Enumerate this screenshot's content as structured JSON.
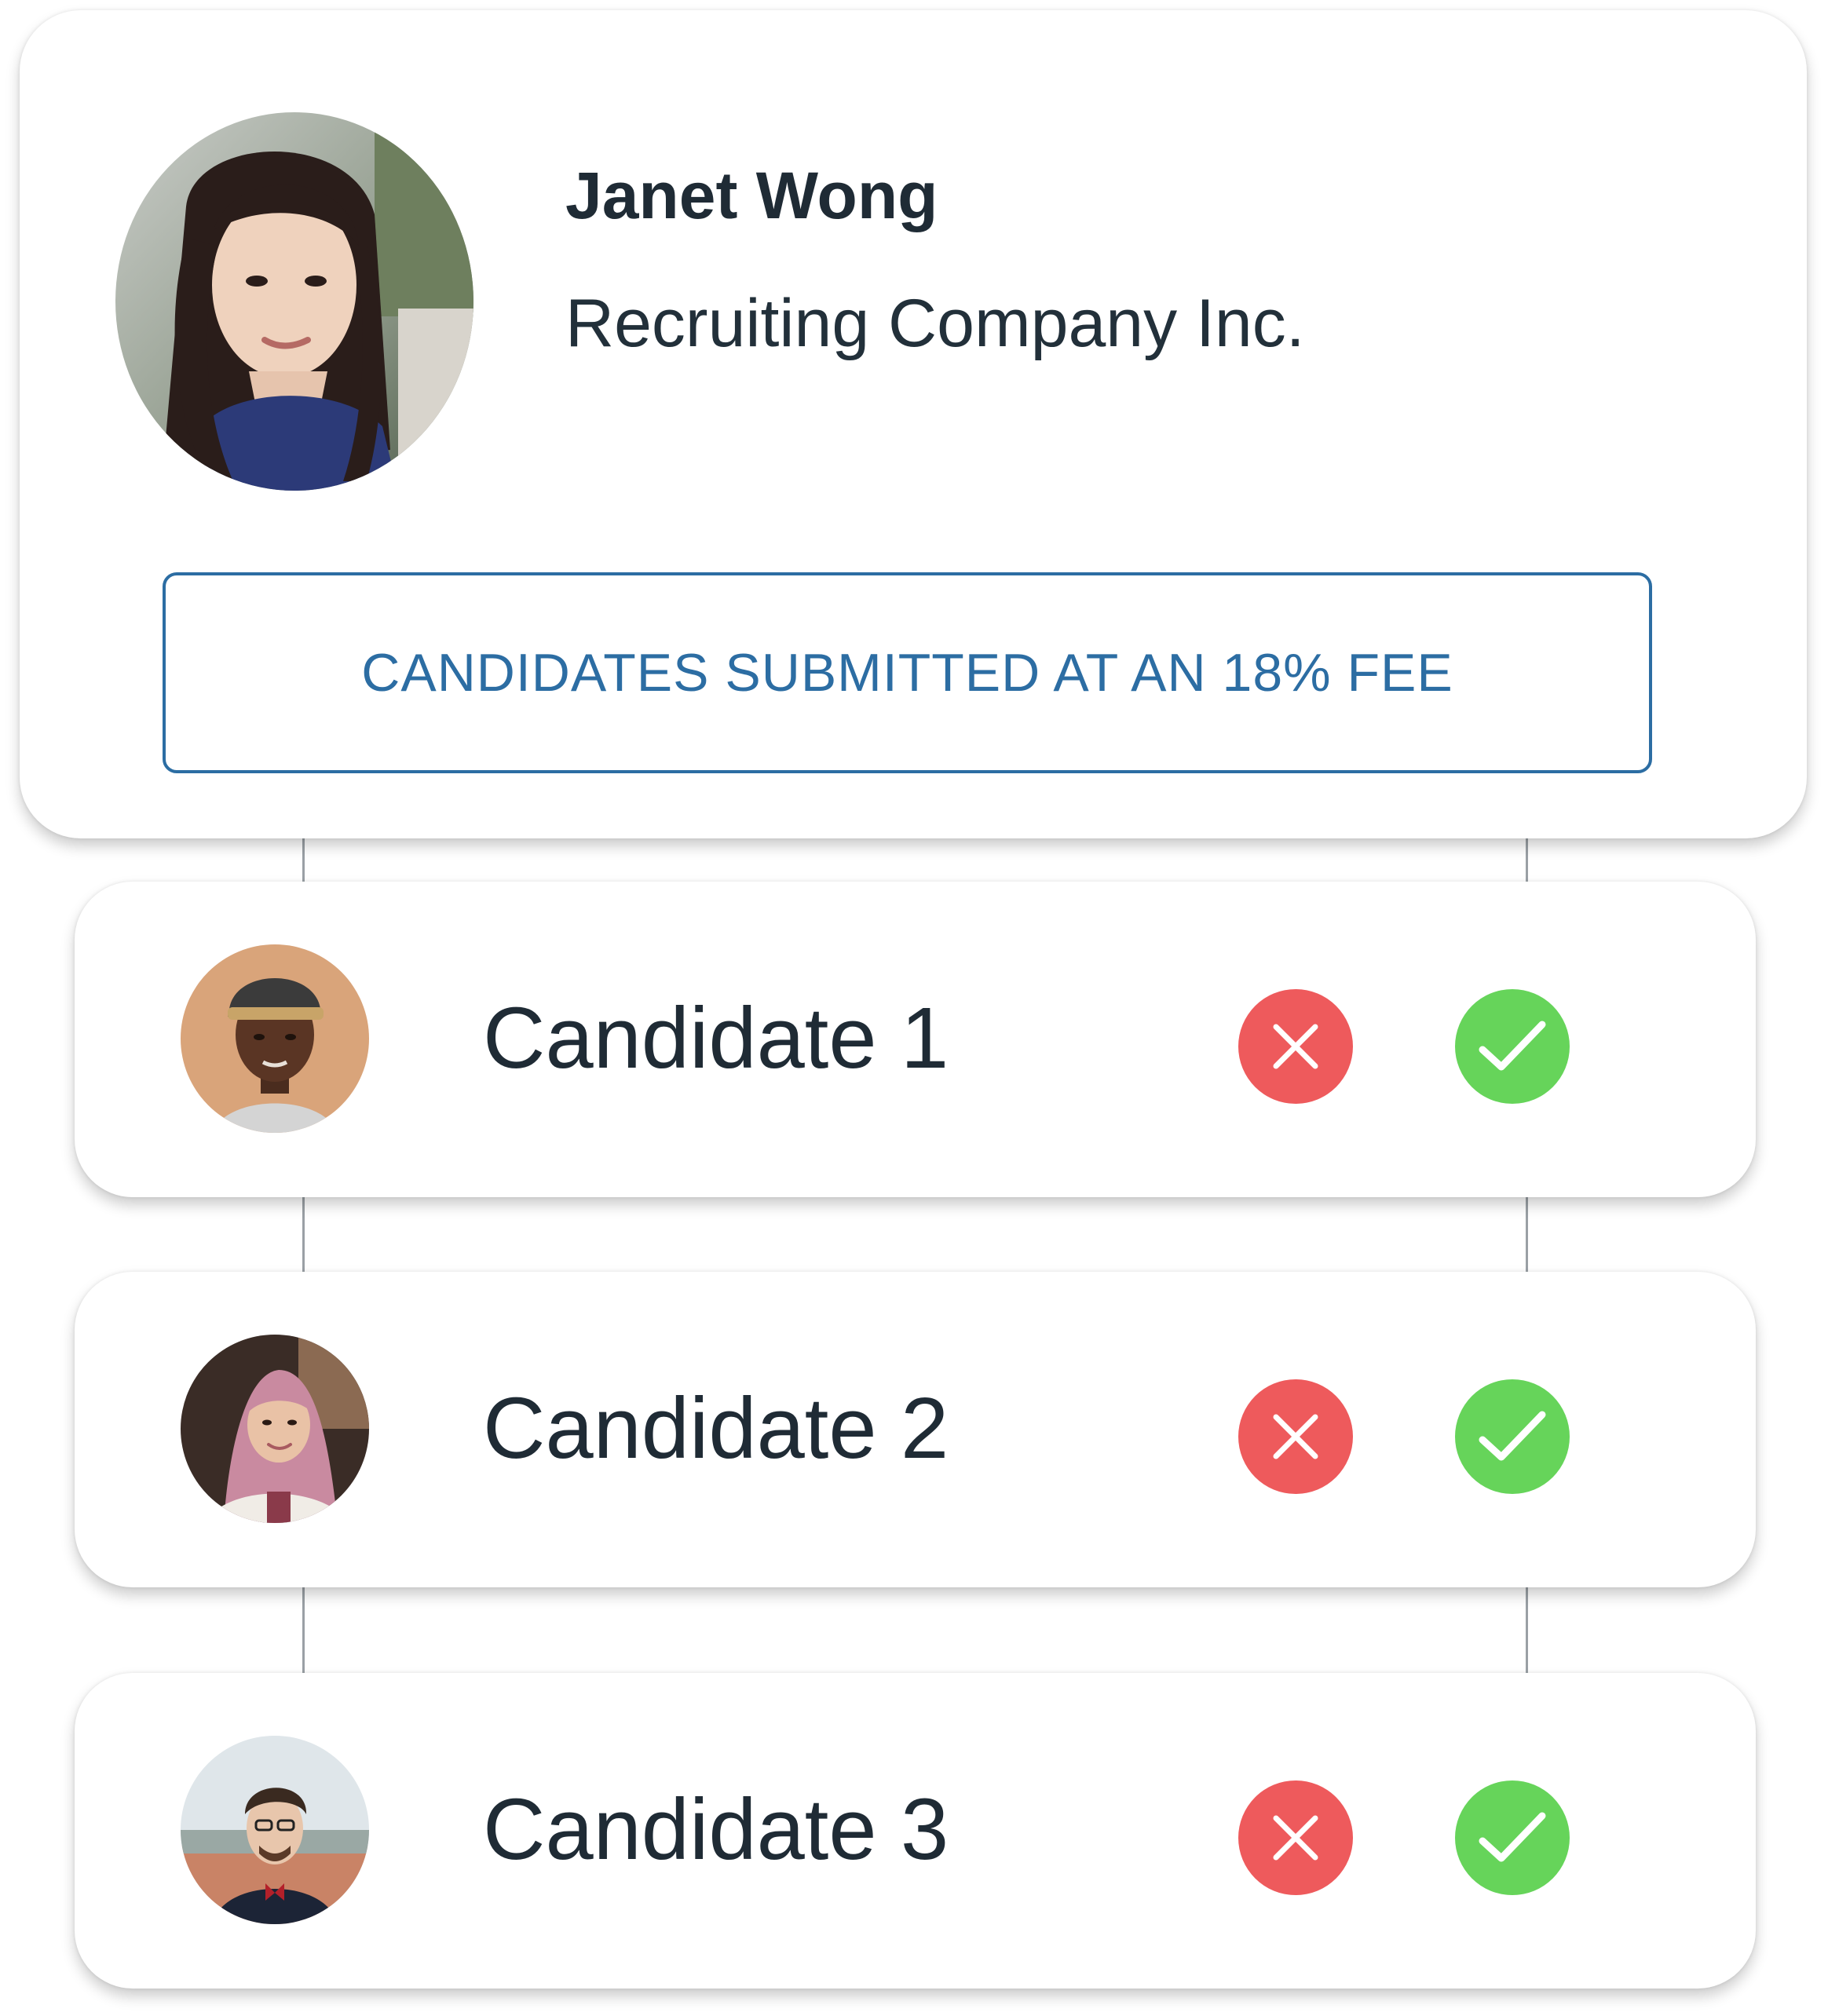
{
  "recruiter": {
    "name": "Janet Wong",
    "company": "Recruiting Company Inc.",
    "fee_notice": "CANDIDATES SUBMITTED AT AN 18% FEE",
    "avatar_icon": "recruiter-photo"
  },
  "candidates": [
    {
      "label": "Candidate 1",
      "avatar_icon": "candidate-photo"
    },
    {
      "label": "Candidate 2",
      "avatar_icon": "candidate-photo"
    },
    {
      "label": "Candidate 3",
      "avatar_icon": "candidate-photo"
    }
  ],
  "actions": {
    "reject_icon": "close-icon",
    "accept_icon": "check-icon"
  },
  "colors": {
    "accent_blue": "#2c6da3",
    "reject_red": "#ee5a5c",
    "accept_green": "#66d45a",
    "text_dark": "#1f2b35",
    "connector_gray": "#9aa0a5"
  }
}
